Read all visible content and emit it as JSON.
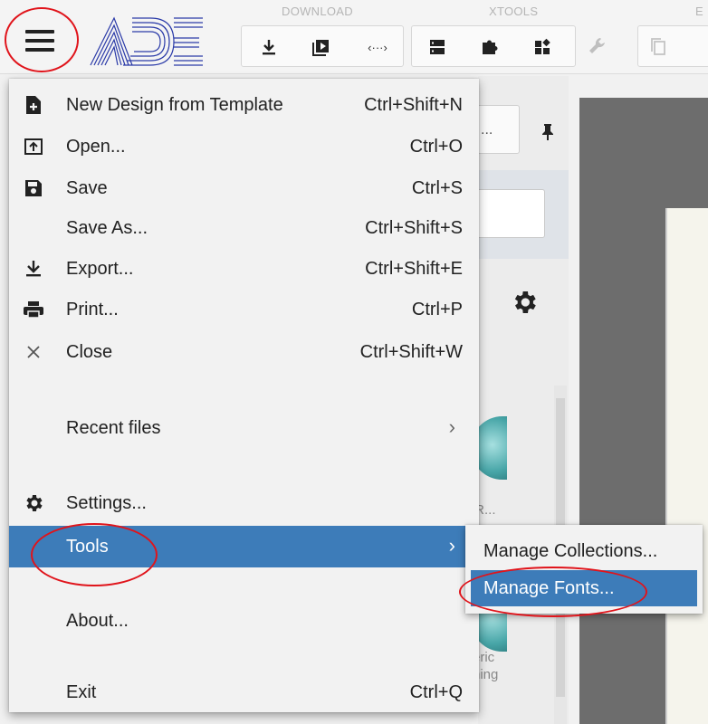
{
  "toolbar": {
    "groups": [
      {
        "label": "DOWNLOAD"
      },
      {
        "label": "XTOOLS"
      },
      {
        "label": "E"
      }
    ],
    "icons": [
      "download-icon",
      "play-icon",
      "code-icon",
      "database-icon",
      "puzzle-icon",
      "widgets-icon",
      "wrench-icon",
      "copy-icon"
    ]
  },
  "side": {
    "panel_button_text": "...",
    "partial_label_1": "/R...",
    "partial_label_2a": "eric",
    "partial_label_2b": "ning"
  },
  "menu": {
    "items": [
      {
        "label": "New Design from Template",
        "shortcut": "Ctrl+Shift+N",
        "icon": "new-file-icon"
      },
      {
        "label": "Open...",
        "shortcut": "Ctrl+O",
        "icon": "open-icon"
      },
      {
        "label": "Save",
        "shortcut": "Ctrl+S",
        "icon": "save-icon"
      },
      {
        "label": "Save As...",
        "shortcut": "Ctrl+Shift+S",
        "icon": ""
      },
      {
        "label": "Export...",
        "shortcut": "Ctrl+Shift+E",
        "icon": "export-icon"
      },
      {
        "label": "Print...",
        "shortcut": "Ctrl+P",
        "icon": "print-icon"
      },
      {
        "label": "Close",
        "shortcut": "Ctrl+Shift+W",
        "icon": "close-icon"
      },
      {
        "label": "Recent files",
        "shortcut": "",
        "icon": "",
        "submenu": true
      },
      {
        "label": "Settings...",
        "shortcut": "",
        "icon": "gear-icon"
      },
      {
        "label": "Tools",
        "shortcut": "",
        "icon": "",
        "submenu": true,
        "active": true
      },
      {
        "label": "About...",
        "shortcut": "",
        "icon": ""
      },
      {
        "label": "Exit",
        "shortcut": "Ctrl+Q",
        "icon": ""
      }
    ],
    "submenu_arrow": "›"
  },
  "submenu": {
    "items": [
      {
        "label": "Manage Collections..."
      },
      {
        "label": "Manage Fonts...",
        "active": true
      }
    ]
  },
  "colors": {
    "accent": "#3d7cb9",
    "annotation": "#e0141b"
  }
}
